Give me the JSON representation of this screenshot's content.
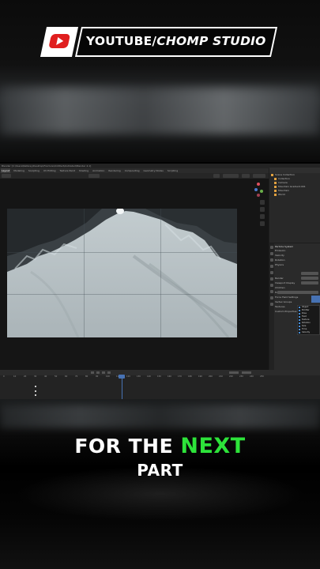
{
  "brand": {
    "prefix": "YOUTUBE/",
    "name": "CHOMP STUDIO",
    "icon": "youtube-play-icon",
    "icon_color": "#e01e1e"
  },
  "blender": {
    "title_bar": "Blender [C:\\Users\\Nefarey\\Desktop\\Fracture\\Untitled\\Outdated\\Blender 4.1]",
    "workspace_tabs": [
      "Layout",
      "Modeling",
      "Sculpting",
      "UV Editing",
      "Texture Paint",
      "Shading",
      "Animation",
      "Rendering",
      "Compositing",
      "Geometry Nodes",
      "Scripting"
    ],
    "active_tab": "Layout",
    "outliner": {
      "rows": [
        "Scene Collection",
        "Collection",
        "Camera",
        "Mountain Gradient.001",
        "Mountain",
        "World"
      ]
    },
    "properties": {
      "panel_title": "Particle System",
      "sections": [
        "Emission",
        "Velocity",
        "Rotation",
        "Physics",
        "Render",
        "Viewport Display",
        "Children",
        "Field Weights",
        "Force Field Settings",
        "Vertex Groups",
        "Textures",
        "Custom Properties"
      ],
      "popup_items": [
        "Object",
        "Emitter",
        "Pose",
        "Field",
        "Texture",
        "Rotation",
        "Size",
        "Time",
        "Velocity"
      ]
    },
    "timeline": {
      "current_frame": "1",
      "ticks": [
        "0",
        "10",
        "20",
        "30",
        "40",
        "50",
        "60",
        "70",
        "80",
        "90",
        "100",
        "110",
        "120",
        "130",
        "140",
        "150",
        "160",
        "170",
        "180",
        "190",
        "200",
        "210",
        "220",
        "230",
        "240",
        "250"
      ]
    },
    "accent_color": "#4772b3"
  },
  "caption": {
    "line1_a": "FOR THE ",
    "line1_b": "NEXT",
    "line2": "PART",
    "accent_color": "#2de33a"
  }
}
